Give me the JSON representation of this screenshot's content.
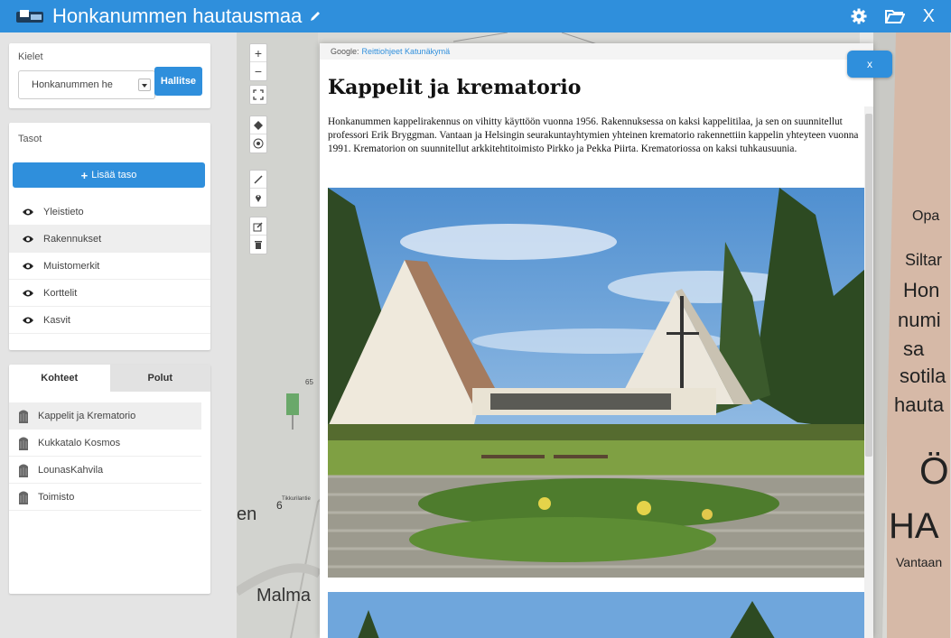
{
  "header": {
    "title": "Honkanummen hautausmaa",
    "close_label": "X"
  },
  "languages": {
    "label": "Kielet",
    "selected": "Honkanummen he",
    "manage_button": "Hallitse"
  },
  "layers": {
    "label": "Tasot",
    "add_button": "Lisää taso",
    "items": [
      {
        "label": "Yleistieto"
      },
      {
        "label": "Rakennukset"
      },
      {
        "label": "Muistomerkit"
      },
      {
        "label": "Korttelit"
      },
      {
        "label": "Kasvit"
      }
    ]
  },
  "targets": {
    "tabs": [
      "Kohteet",
      "Polut"
    ],
    "items": [
      {
        "label": "Kappelit ja Krematorio"
      },
      {
        "label": "Kukkatalo Kosmos"
      },
      {
        "label": "LounasKahvila"
      },
      {
        "label": "Toimisto"
      }
    ]
  },
  "map": {
    "labels": [
      "Malma",
      "Opa",
      "Siltar",
      "Hon",
      "numi",
      "sa",
      "sotila",
      "hauta",
      "Ö",
      "HA",
      "Vantaan",
      "en",
      "6",
      "65",
      "Tikkurilantie"
    ],
    "tools": [
      "+",
      "−"
    ]
  },
  "popup": {
    "google_prefix": "Google:",
    "google_links": "Reittiohjeet Katunäkymä",
    "close_label": "x",
    "title": "Kappelit ja krematorio",
    "text": "Honkanummen kappelirakennus on vihitty käyttöön vuonna 1956. Rakennuksessa on kaksi kappelitilaa, ja sen on suunnitellut professori Erik Bryggman. Vantaan ja Helsingin seurakuntayhtymien yhteinen krematorio rakennettiin kappelin yhteyteen vuonna 1991. Krematorion on suunnitellut arkkitehtitoimisto Pirkko ja Pekka Piirta. Krematoriossa on kaksi tuhkausuunia."
  },
  "colors": {
    "accent": "#2f8fdc",
    "panel_bg": "#e4e4e4"
  }
}
